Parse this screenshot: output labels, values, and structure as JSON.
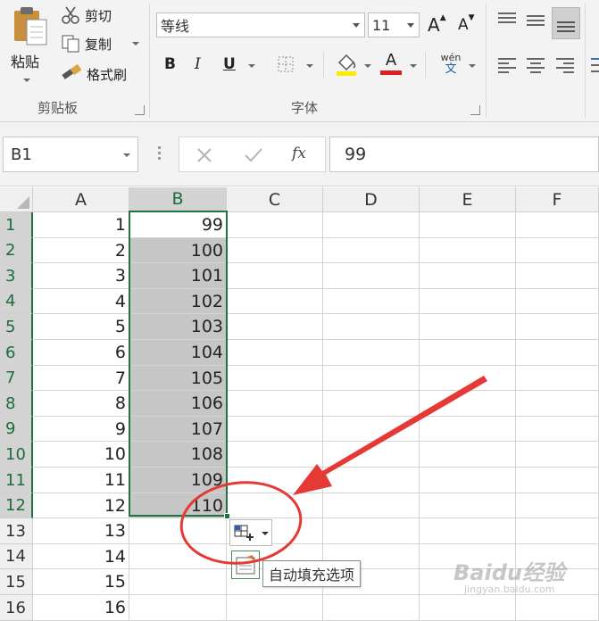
{
  "ribbon": {
    "clipboard": {
      "paste_label": "粘贴",
      "cut_label": "剪切",
      "copy_label": "复制",
      "format_painter_label": "格式刷",
      "group_label": "剪贴板"
    },
    "font": {
      "font_name": "等线",
      "font_size": "11",
      "bold_label": "B",
      "italic_label": "I",
      "underline_label": "U",
      "font_color_label": "A",
      "increase_font_label": "A",
      "decrease_font_label": "A",
      "phonetic_label": "wén",
      "phonetic_sub": "文",
      "group_label": "字体"
    }
  },
  "formula_bar": {
    "name_box": "B1",
    "fx_label": "fx",
    "formula_value": "99"
  },
  "sheet": {
    "columns": [
      "A",
      "B",
      "C",
      "D",
      "E",
      "F"
    ],
    "rows": [
      {
        "num": "1",
        "a": "1",
        "b": "99"
      },
      {
        "num": "2",
        "a": "2",
        "b": "100"
      },
      {
        "num": "3",
        "a": "3",
        "b": "101"
      },
      {
        "num": "4",
        "a": "4",
        "b": "102"
      },
      {
        "num": "5",
        "a": "5",
        "b": "103"
      },
      {
        "num": "6",
        "a": "6",
        "b": "104"
      },
      {
        "num": "7",
        "a": "7",
        "b": "105"
      },
      {
        "num": "8",
        "a": "8",
        "b": "106"
      },
      {
        "num": "9",
        "a": "9",
        "b": "107"
      },
      {
        "num": "10",
        "a": "10",
        "b": "108"
      },
      {
        "num": "11",
        "a": "11",
        "b": "109"
      },
      {
        "num": "12",
        "a": "12",
        "b": "110"
      },
      {
        "num": "13",
        "a": "13",
        "b": ""
      },
      {
        "num": "14",
        "a": "14",
        "b": ""
      },
      {
        "num": "15",
        "a": "15",
        "b": ""
      },
      {
        "num": "16",
        "a": "16",
        "b": ""
      }
    ]
  },
  "autofill": {
    "tooltip": "自动填充选项"
  },
  "watermark": {
    "text": "Baidu经验",
    "sub": "jingyan.baidu.com"
  },
  "colors": {
    "selection_border": "#217346",
    "selection_fill": "#c6c6c6",
    "annotation_red": "#e53935"
  }
}
